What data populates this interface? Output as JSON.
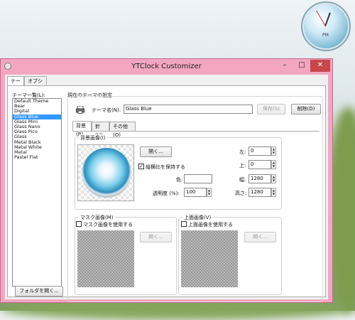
{
  "desktop": {
    "clock_label": "PM"
  },
  "window": {
    "title": "YTClock Customizer",
    "controls": {
      "minimize": "–",
      "maximize": "□",
      "close": "✕"
    }
  },
  "tabs": [
    {
      "label": "テーマ"
    },
    {
      "label": "オプション"
    }
  ],
  "theme_list": {
    "label": "テーマ一覧(L):",
    "items": [
      "Default Theme",
      "Bear",
      "Digital",
      "Glass Blue",
      "Glass Mini",
      "Glass Nano",
      "Glass Pico",
      "Glass",
      "Metal Black",
      "Metal White",
      "Metal",
      "Pastel Flat"
    ],
    "selected": "Glass Blue",
    "open_folder_button": "フォルダを開く..."
  },
  "current_theme": {
    "group_label": "現在のテーマの設定",
    "name_label": "テーマ名(N):",
    "name_value": "Glass Blue",
    "save_button": "保存(S)",
    "delete_button": "削除(D)",
    "subtabs": [
      {
        "label": "背景(B)"
      },
      {
        "label": "針(H)"
      },
      {
        "label": "その他(O)"
      }
    ]
  },
  "background": {
    "group_label": "背景画像(I)",
    "open_button": "開く...",
    "keep_aspect_label": "縦横比を保持する",
    "keep_aspect_checked": true,
    "color_label": "色:",
    "opacity_label": "透明度 (%):",
    "opacity_value": "100",
    "left_label": "左:",
    "left_value": "0",
    "top_label": "上:",
    "top_value": "0",
    "width_label": "幅:",
    "width_value": "1280",
    "height_label": "高さ:",
    "height_value": "1280"
  },
  "mask": {
    "group_label": "マスク画像(M)",
    "use_label": "マスク画像を使用する",
    "open_button": "開く..."
  },
  "overlay": {
    "group_label": "上面画像(V)",
    "use_label": "上面画像を使用する",
    "open_button": "開く..."
  },
  "colors": {
    "titlebar": "#f4a6c1",
    "close": "#c7474a",
    "selection": "#3399ff"
  }
}
